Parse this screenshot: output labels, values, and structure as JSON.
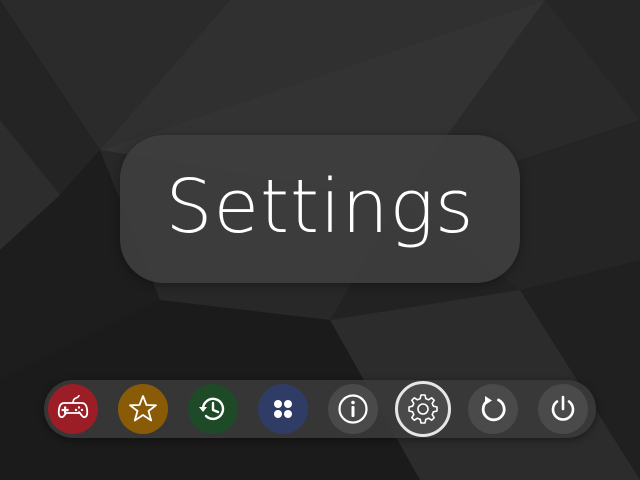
{
  "screen": {
    "title": "Settings"
  },
  "dock": {
    "selected": "settings",
    "items": [
      {
        "id": "games",
        "icon": "gamepad-icon",
        "color": "#9b1e26"
      },
      {
        "id": "favorites",
        "icon": "star-icon",
        "color": "#8a5b06"
      },
      {
        "id": "history",
        "icon": "history-icon",
        "color": "#1e4a27"
      },
      {
        "id": "collections",
        "icon": "grid-dots-icon",
        "color": "#2f3c66"
      },
      {
        "id": "info",
        "icon": "info-icon",
        "color": "#4a4a4a"
      },
      {
        "id": "settings",
        "icon": "gear-icon",
        "color": "#4a4a4a"
      },
      {
        "id": "restart",
        "icon": "restart-icon",
        "color": "#4a4a4a"
      },
      {
        "id": "power",
        "icon": "power-icon",
        "color": "#4a4a4a"
      }
    ]
  },
  "colors": {
    "background": "#1f1f1f",
    "card": "#3e3e3e",
    "text": "#ffffff"
  }
}
